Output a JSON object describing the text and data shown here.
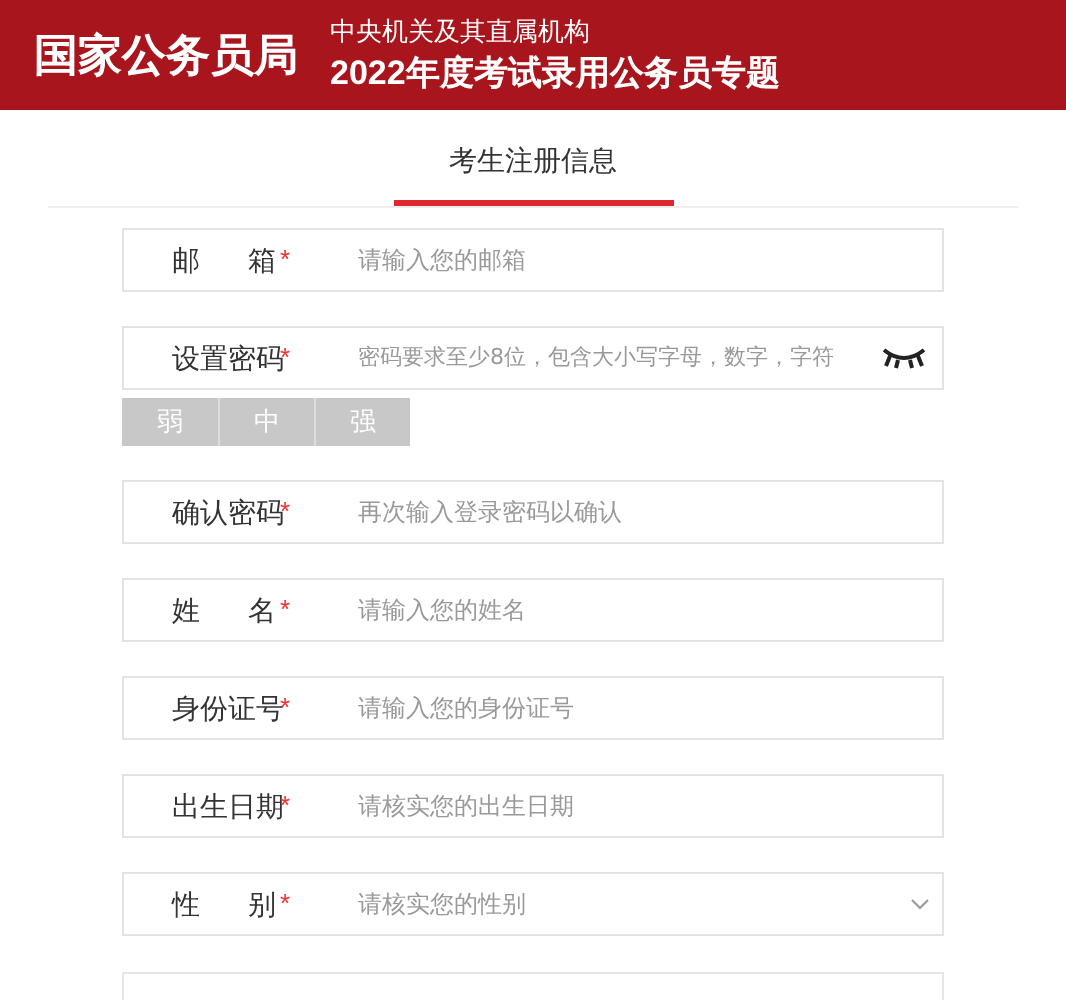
{
  "header": {
    "logo": "国家公务员局",
    "subtitle": "中央机关及其直属机构",
    "title": "2022年度考试录用公务员专题"
  },
  "tabs": [
    {
      "label": "考生注册信息",
      "selected": true
    }
  ],
  "fields": [
    {
      "kind": "text",
      "label": "邮箱",
      "required_mark": "*",
      "placeholder": "请输入您的邮箱"
    },
    {
      "kind": "password",
      "label": "设置密码",
      "required_mark": "*",
      "placeholder": "密码要求至少8位，包含大小写字母，数字，字符",
      "strength": [
        "弱",
        "中",
        "强"
      ]
    },
    {
      "kind": "text",
      "label": "确认密码",
      "required_mark": "*",
      "placeholder": "再次输入登录密码以确认"
    },
    {
      "kind": "text",
      "label": "姓名",
      "required_mark": "*",
      "placeholder": "请输入您的姓名"
    },
    {
      "kind": "text",
      "label": "身份证号",
      "required_mark": "*",
      "placeholder": "请输入您的身份证号"
    },
    {
      "kind": "text",
      "label": "出生日期",
      "required_mark": "*",
      "placeholder": "请核实您的出生日期"
    },
    {
      "kind": "select",
      "label": "性别",
      "required_mark": "*",
      "placeholder": "请核实您的性别"
    },
    {
      "kind": "empty"
    }
  ]
}
